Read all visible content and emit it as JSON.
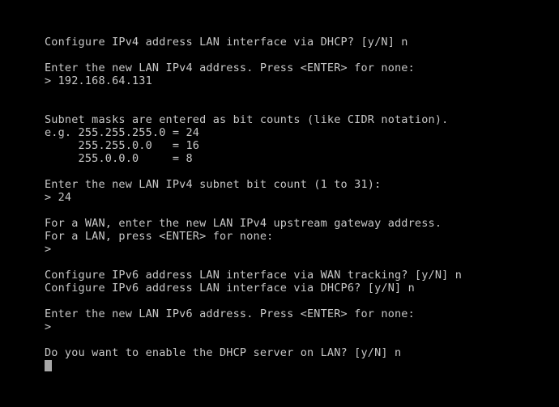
{
  "terminal": {
    "background_color": "#000000",
    "text_color": "#c8c8c8",
    "cursor_color": "#a8a8a8",
    "lines": [
      "Configure IPv4 address LAN interface via DHCP? [y/N] n",
      "",
      "Enter the new LAN IPv4 address. Press <ENTER> for none:",
      "> 192.168.64.131",
      "",
      "",
      "Subnet masks are entered as bit counts (like CIDR notation).",
      "e.g. 255.255.255.0 = 24",
      "     255.255.0.0   = 16",
      "     255.0.0.0     = 8",
      "",
      "Enter the new LAN IPv4 subnet bit count (1 to 31):",
      "> 24",
      "",
      "For a WAN, enter the new LAN IPv4 upstream gateway address.",
      "For a LAN, press <ENTER> for none:",
      ">",
      "",
      "Configure IPv6 address LAN interface via WAN tracking? [y/N] n",
      "Configure IPv6 address LAN interface via DHCP6? [y/N] n",
      "",
      "Enter the new LAN IPv6 address. Press <ENTER> for none:",
      ">",
      "",
      "Do you want to enable the DHCP server on LAN? [y/N] n"
    ],
    "prompts": {
      "ipv4_dhcp_prompt": "Configure IPv4 address LAN interface via DHCP? [y/N]",
      "ipv4_dhcp_answer": "n",
      "ipv4_address_prompt": "Enter the new LAN IPv4 address. Press <ENTER> for none:",
      "ipv4_address_value": "192.168.64.131",
      "subnet_info": "Subnet masks are entered as bit counts (like CIDR notation).",
      "subnet_examples": [
        {
          "label": "e.g.",
          "mask": "255.255.255.0",
          "bits": "24"
        },
        {
          "label": "",
          "mask": "255.255.0.0",
          "bits": "16"
        },
        {
          "label": "",
          "mask": "255.0.0.0",
          "bits": "8"
        }
      ],
      "subnet_bits_prompt": "Enter the new LAN IPv4 subnet bit count (1 to 31):",
      "subnet_bits_value": "24",
      "gateway_prompt_line1": "For a WAN, enter the new LAN IPv4 upstream gateway address.",
      "gateway_prompt_line2": "For a LAN, press <ENTER> for none:",
      "gateway_value": "",
      "ipv6_wan_tracking_prompt": "Configure IPv6 address LAN interface via WAN tracking? [y/N]",
      "ipv6_wan_tracking_answer": "n",
      "ipv6_dhcp6_prompt": "Configure IPv6 address LAN interface via DHCP6? [y/N]",
      "ipv6_dhcp6_answer": "n",
      "ipv6_address_prompt": "Enter the new LAN IPv6 address. Press <ENTER> for none:",
      "ipv6_address_value": "",
      "dhcp_server_prompt": "Do you want to enable the DHCP server on LAN? [y/N]",
      "dhcp_server_answer": "n"
    },
    "prompt_symbol": ">"
  }
}
